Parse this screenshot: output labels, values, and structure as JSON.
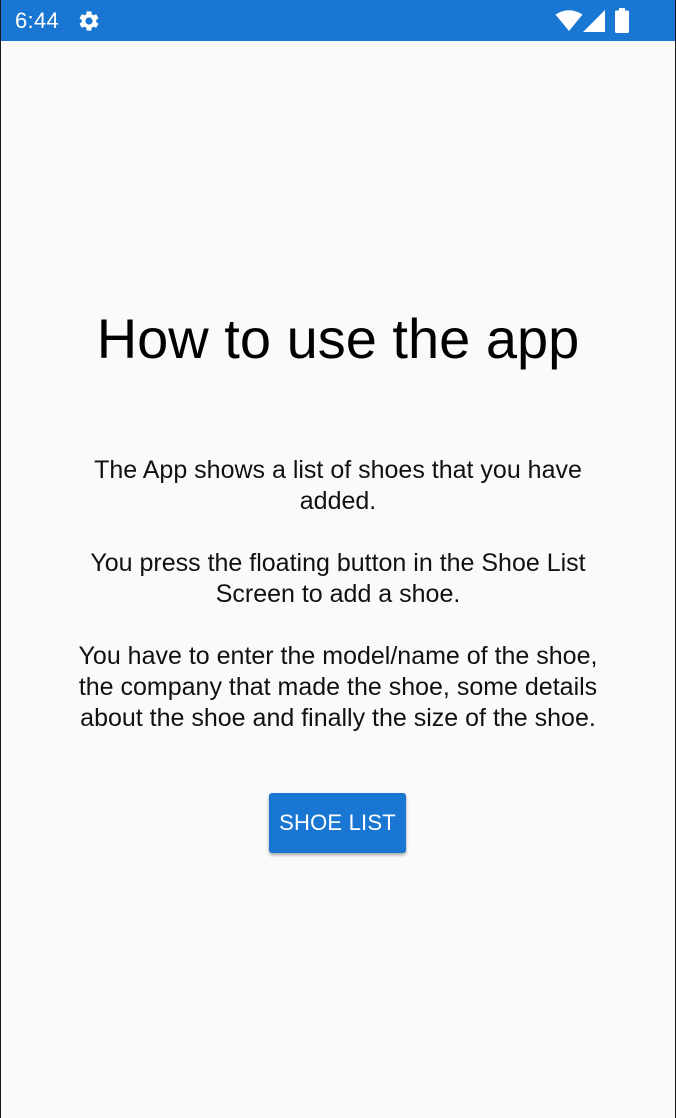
{
  "status_bar": {
    "time": "6:44",
    "icons": [
      "gear-icon",
      "wifi-icon",
      "signal-icon",
      "battery-icon"
    ],
    "color": "#1976d2"
  },
  "instructions_screen": {
    "title": "How to use the app",
    "body": "The App shows a list of shoes that you have added.\n\nYou press the floating button in the Shoe List Screen to add a shoe.\n\nYou have to enter the model/name of the shoe, the company that made the shoe, some details about the shoe and finally the size of the shoe.",
    "shoe_list_button_label": "SHOE LIST"
  },
  "colors": {
    "accent": "#1976d2",
    "background": "#fafafa"
  }
}
